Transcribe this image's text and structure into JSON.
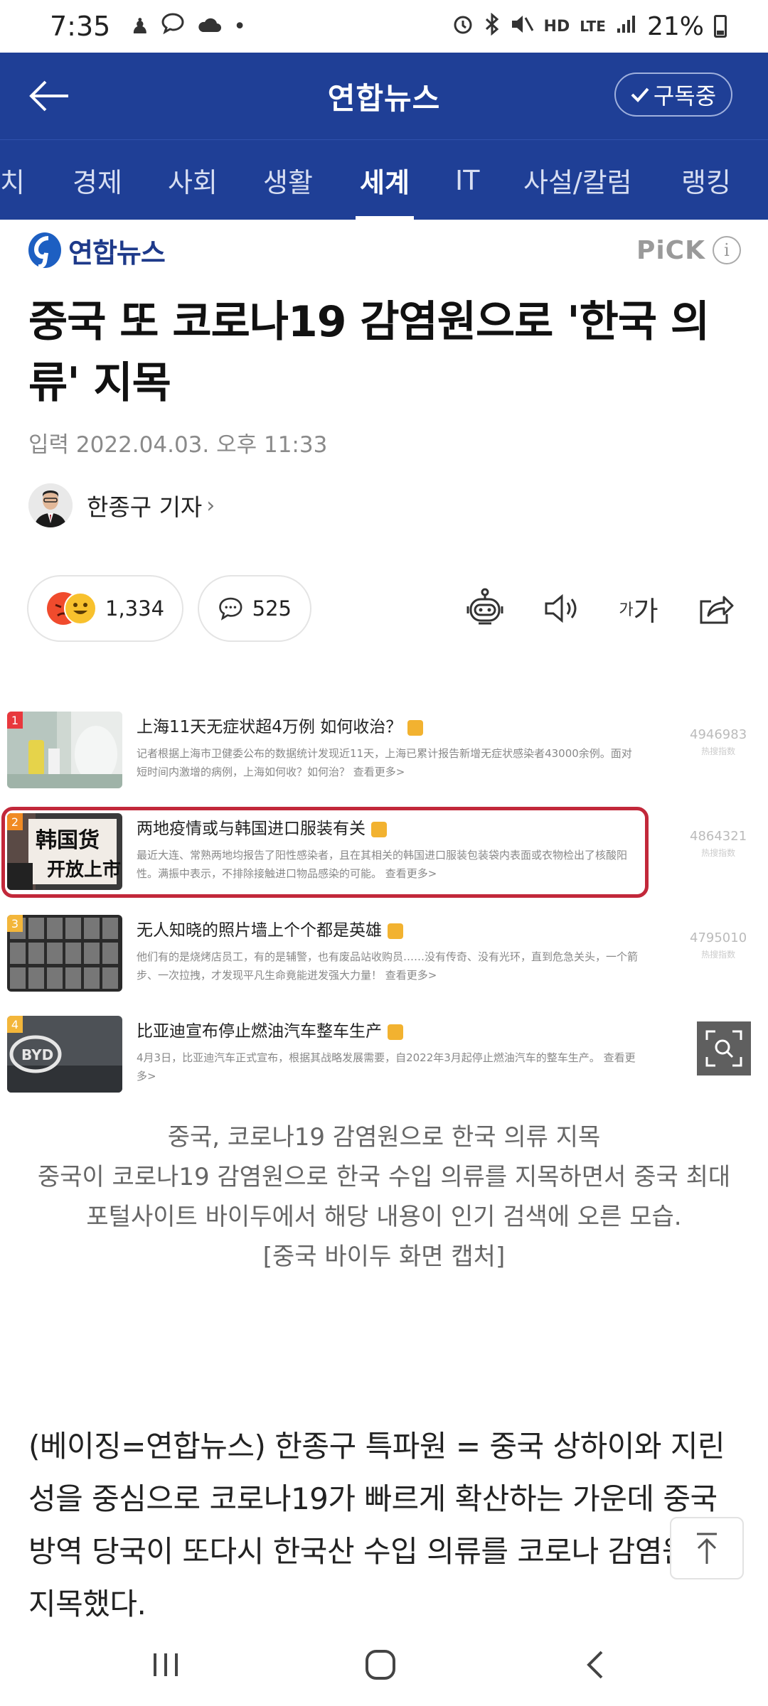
{
  "status_bar": {
    "time": "7:35",
    "battery": "21%",
    "network": "LTE",
    "hd_voice": "HD"
  },
  "header": {
    "title": "연합뉴스",
    "subscribe_label": "구독중"
  },
  "tabs": [
    {
      "label": "치",
      "active": false
    },
    {
      "label": "경제",
      "active": false
    },
    {
      "label": "사회",
      "active": false
    },
    {
      "label": "생활",
      "active": false
    },
    {
      "label": "세계",
      "active": true
    },
    {
      "label": "IT",
      "active": false
    },
    {
      "label": "사설/칼럼",
      "active": false
    },
    {
      "label": "랭킹",
      "active": false
    }
  ],
  "article": {
    "publisher": "연합뉴스",
    "pick_label": "PiCK",
    "info_label": "i",
    "headline": "중국 또 코로나19 감염원으로 '한국 의류' 지목",
    "date": "입력 2022.04.03. 오후 11:33",
    "author": "한종구 기자",
    "author_chevron": "›",
    "reaction_count": "1,334",
    "comment_count": "525",
    "font_tool_small": "가",
    "font_tool_big": "가"
  },
  "image": {
    "rows": [
      {
        "rank": "1",
        "title": "上海11天无症状超4万例 如何收治？",
        "desc": "记者根据上海市卫健委公布的数据统计发现近11天，上海已累计报告新增无症状感染者43000余例。面对短时间内激增的病例，上海如何收？如何治？ 查看更多>",
        "score": "4946983",
        "score_label": "热搜指数",
        "rank_color": "#e8383d"
      },
      {
        "rank": "2",
        "title": "两地疫情或与韩国进口服装有关",
        "desc": "最近大连、常熟两地均报告了阳性感染者，且在其相关的韩国进口服装包装袋内表面或衣物检出了核酸阳性。满振中表示，不排除接触进口物品感染的可能。 查看更多>",
        "score": "4864321",
        "score_label": "热搜指数",
        "rank_color": "#f08a24"
      },
      {
        "rank": "3",
        "title": "无人知晓的照片墙上个个都是英雄",
        "desc": "他们有的是烧烤店员工，有的是辅警，也有废品站收购员……没有传奇、没有光环，直到危急关头，一个箭步、一次拉拽，才发现平凡生命竟能迸发强大力量！ 查看更多>",
        "score": "4795010",
        "score_label": "热搜指数",
        "rank_color": "#f3b63a"
      },
      {
        "rank": "4",
        "title": "比亚迪宣布停止燃油汽车整车生产",
        "desc": "4月3日，比亚迪汽车正式宣布，根据其战略发展需要，自2022年3月起停止燃油汽车的整车生产。 查看更多>",
        "score": "",
        "score_label": "",
        "rank_color": "#f3b63a"
      }
    ],
    "thumb_text_row2": "韩国货\n开放上市"
  },
  "caption": {
    "line1": "중국, 코로나19 감염원으로 한국 의류 지목",
    "line2": "중국이 코로나19 감염원으로 한국 수입 의류를 지목하면서 중국 최대 포털사이트 바이두에서 해당 내용이 인기 검색에 오른 모습.",
    "line3": "[중국 바이두 화면 캡처]"
  },
  "body": {
    "paragraph": "(베이징=연합뉴스) 한종구 특파원 = 중국 상하이와 지린성을 중심으로 코로나19가 빠르게 확산하는 가운데 중국 방역 당국이 또다시 한국산 수입 의류를 코로나 감염원으로 지목했다."
  },
  "colors": {
    "header_bg": "#1f3f96",
    "highlight_border": "#c2283a",
    "publisher_blue": "#1e3a8a"
  }
}
